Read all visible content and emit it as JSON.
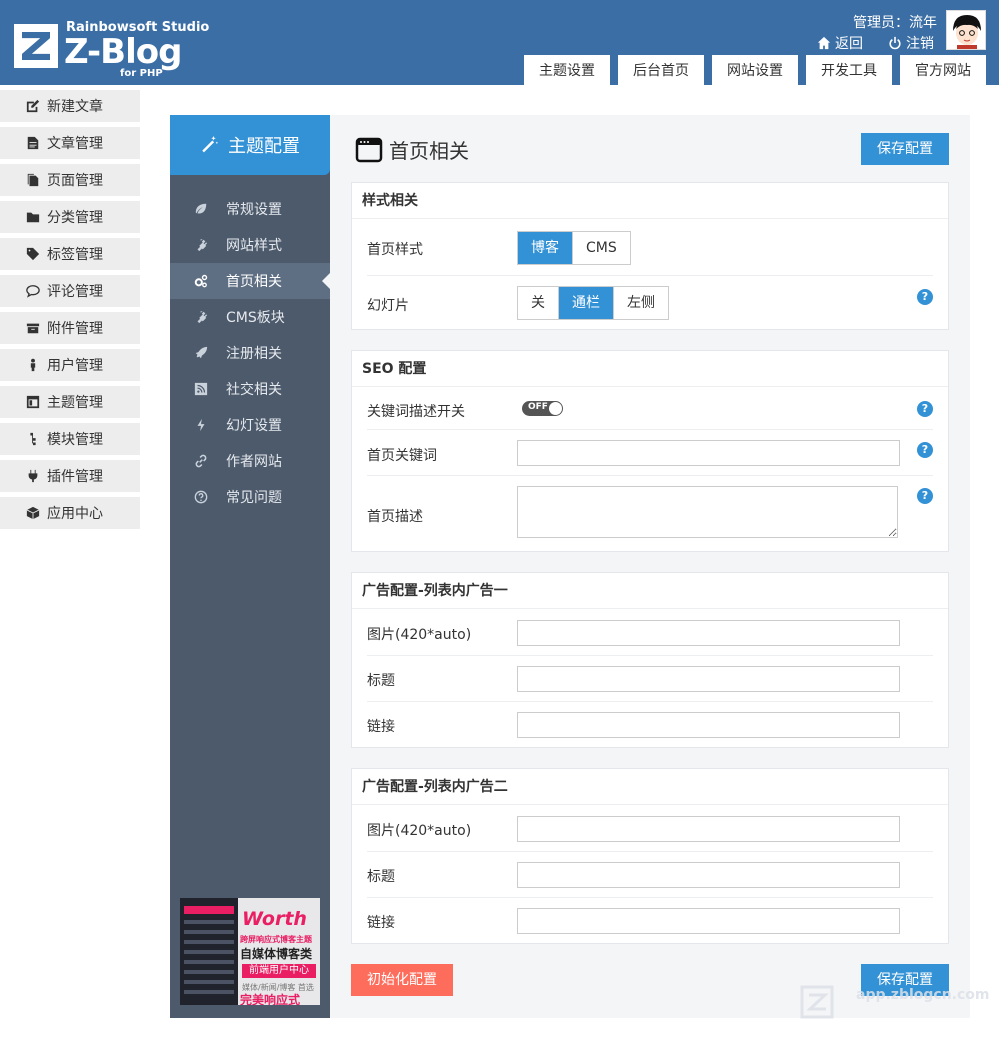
{
  "header": {
    "logo_studio": "Rainbowsoft Studio",
    "logo_name": "Z-Blog",
    "logo_sub": "for PHP",
    "admin": "管理员：流年",
    "back": "返回",
    "logout": "注销",
    "tabs": [
      "主题设置",
      "后台首页",
      "网站设置",
      "开发工具",
      "官方网站"
    ]
  },
  "leftmenu": [
    "新建文章",
    "文章管理",
    "页面管理",
    "分类管理",
    "标签管理",
    "评论管理",
    "附件管理",
    "用户管理",
    "主题管理",
    "模块管理",
    "插件管理",
    "应用中心"
  ],
  "sidenav": {
    "title": "主题配置",
    "items": [
      "常规设置",
      "网站样式",
      "首页相关",
      "CMS板块",
      "注册相关",
      "社交相关",
      "幻灯设置",
      "作者网站",
      "常见问题"
    ],
    "active_index": 2
  },
  "promo": {
    "title": "Worth",
    "line1": "跨屏响应式博客主题",
    "line2": "自媒体博客类",
    "line3": "前端用户中心",
    "line4": "媒体/新闻/博客 首选",
    "line5": "完美响应式"
  },
  "main": {
    "title": "首页相关",
    "save_label": "保存配置",
    "reset_label": "初始化配置",
    "style_section": {
      "heading": "样式相关",
      "home_style_label": "首页样式",
      "home_style_options": [
        "博客",
        "CMS"
      ],
      "home_style_selected": "博客",
      "slide_label": "幻灯片",
      "slide_options": [
        "关",
        "通栏",
        "左侧"
      ],
      "slide_selected": "通栏"
    },
    "seo_section": {
      "heading": "SEO 配置",
      "switch_label": "关键词描述开关",
      "switch_text": "OFF",
      "keywords_label": "首页关键词",
      "desc_label": "首页描述",
      "keywords_value": "",
      "desc_value": ""
    },
    "ad1": {
      "heading": "广告配置-列表内广告一",
      "image_label": "图片(420*auto)",
      "title_label": "标题",
      "link_label": "链接",
      "image_value": "",
      "title_value": "",
      "link_value": ""
    },
    "ad2": {
      "heading": "广告配置-列表内广告二",
      "image_label": "图片(420*auto)",
      "title_label": "标题",
      "link_label": "链接",
      "image_value": "",
      "title_value": "",
      "link_value": ""
    },
    "help_glyph": "?"
  },
  "watermark": "app.zblogcn.com",
  "colors": {
    "header_bg": "#3a6ea5",
    "accent": "#3391d5",
    "sidenav_bg": "#4c5a6b",
    "reset_button": "#fe6d5c"
  }
}
